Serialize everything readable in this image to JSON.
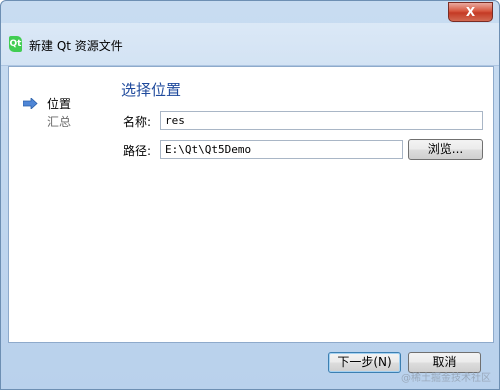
{
  "titlebar": {
    "close_glyph": "X"
  },
  "wizard": {
    "icon_letter": "Qt",
    "icon": "qt-creator-icon",
    "title": "新建 Qt 资源文件"
  },
  "nav": {
    "current_icon": "right-arrow-icon",
    "items": [
      {
        "label": "位置",
        "current": true
      },
      {
        "label": "汇总",
        "current": false
      }
    ]
  },
  "page": {
    "title": "选择位置",
    "name_label": "名称:",
    "name_value": "res",
    "path_label": "路径:",
    "path_value": "E:\\Qt\\Qt5Demo",
    "browse_label": "浏览..."
  },
  "footer": {
    "next_label": "下一步(N)",
    "cancel_label": "取消"
  },
  "watermark": "@稀土掘金技术社区",
  "colors": {
    "frame": "#b9d1ec",
    "page_title": "#1f4a9c",
    "close_button": "#c43a25",
    "qt_green": "#41cd52"
  }
}
